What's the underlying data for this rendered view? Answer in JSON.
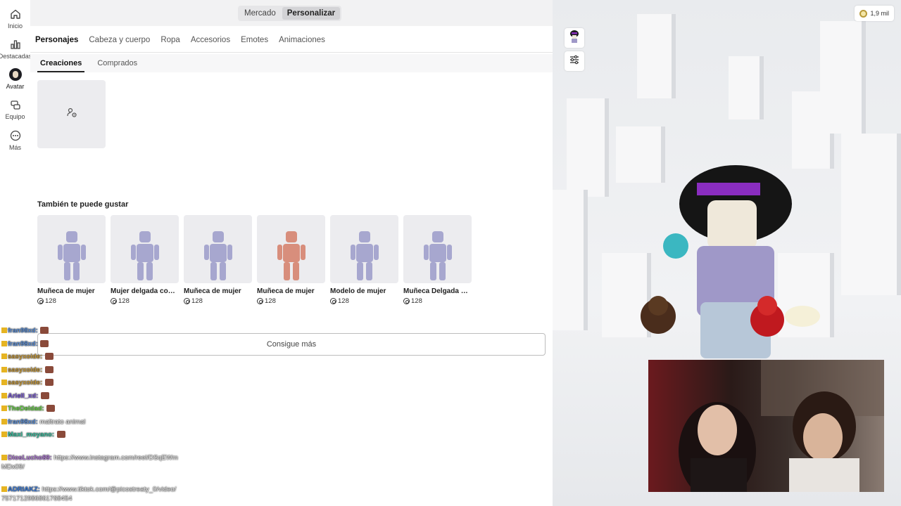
{
  "nav": {
    "items": [
      {
        "label": "Inicio",
        "icon": "home-icon"
      },
      {
        "label": "Destacadas",
        "icon": "charts-icon"
      },
      {
        "label": "Avatar",
        "icon": "avatar-icon"
      },
      {
        "label": "Equipo",
        "icon": "party-icon"
      },
      {
        "label": "Más",
        "icon": "more-icon"
      }
    ]
  },
  "top": {
    "segments": [
      "Mercado",
      "Personalizar"
    ],
    "active_segment": "Personalizar"
  },
  "categories": [
    "Personajes",
    "Cabeza y cuerpo",
    "Ropa",
    "Accesorios",
    "Emotes",
    "Animaciones"
  ],
  "active_category": "Personajes",
  "subtabs": [
    "Creaciones",
    "Comprados"
  ],
  "active_subtab": "Creaciones",
  "recommend": {
    "title": "También te puede gustar",
    "items": [
      {
        "name": "Muñeca de mujer",
        "price": "128",
        "color": "#a7a7cf"
      },
      {
        "name": "Mujer delgada con ...",
        "price": "128",
        "color": "#a7a7cf"
      },
      {
        "name": "Muñeca de mujer",
        "price": "128",
        "color": "#a7a7cf"
      },
      {
        "name": "Muñeca de mujer",
        "price": "128",
        "color": "#d88e7c"
      },
      {
        "name": "Modelo de mujer",
        "price": "128",
        "color": "#a7a7cf"
      },
      {
        "name": "Muñeca Delgada M...",
        "price": "128",
        "color": "#a7a7cf"
      }
    ],
    "more_label": "Consigue más"
  },
  "wallet": {
    "balance": "1,9 mil"
  },
  "chat": [
    {
      "user": "fran98xd:",
      "msg": "",
      "color": "#5a8ed6"
    },
    {
      "user": "fran98xd:",
      "msg": "",
      "color": "#5a8ed6"
    },
    {
      "user": "sasyxoide:",
      "msg": "",
      "color": "#c89a3a"
    },
    {
      "user": "sasyxoide:",
      "msg": "",
      "color": "#c89a3a"
    },
    {
      "user": "sasyxoide:",
      "msg": "",
      "color": "#c89a3a"
    },
    {
      "user": "Ariell_xd:",
      "msg": "",
      "color": "#7a5ad6"
    },
    {
      "user": "TheDeidad:",
      "msg": "",
      "color": "#6bd64a"
    },
    {
      "user": "fran98xd:",
      "msg": "maltrato animal",
      "color": "#5a8ed6"
    },
    {
      "user": "Maxi_moyano:",
      "msg": "",
      "color": "#3ac0a0"
    },
    {
      "user": "DiosLucho89:",
      "msg": "https://www.instagram.com/reel/DSqEWm",
      "color": "#b07ad6"
    },
    {
      "user": "",
      "msg": "MDx09/",
      "color": "#f0f0f0"
    },
    {
      "user": "ADRIAKZ:",
      "msg": "https://www.tiktok.com/@picostreaty_0/video/",
      "color": "#3a7ad6"
    },
    {
      "user": "",
      "msg": "7571712986861768454",
      "color": "#f0f0f0"
    }
  ],
  "colors": {
    "accent": "#222222",
    "panel": "#ececef",
    "viewport": "#eceef1"
  }
}
